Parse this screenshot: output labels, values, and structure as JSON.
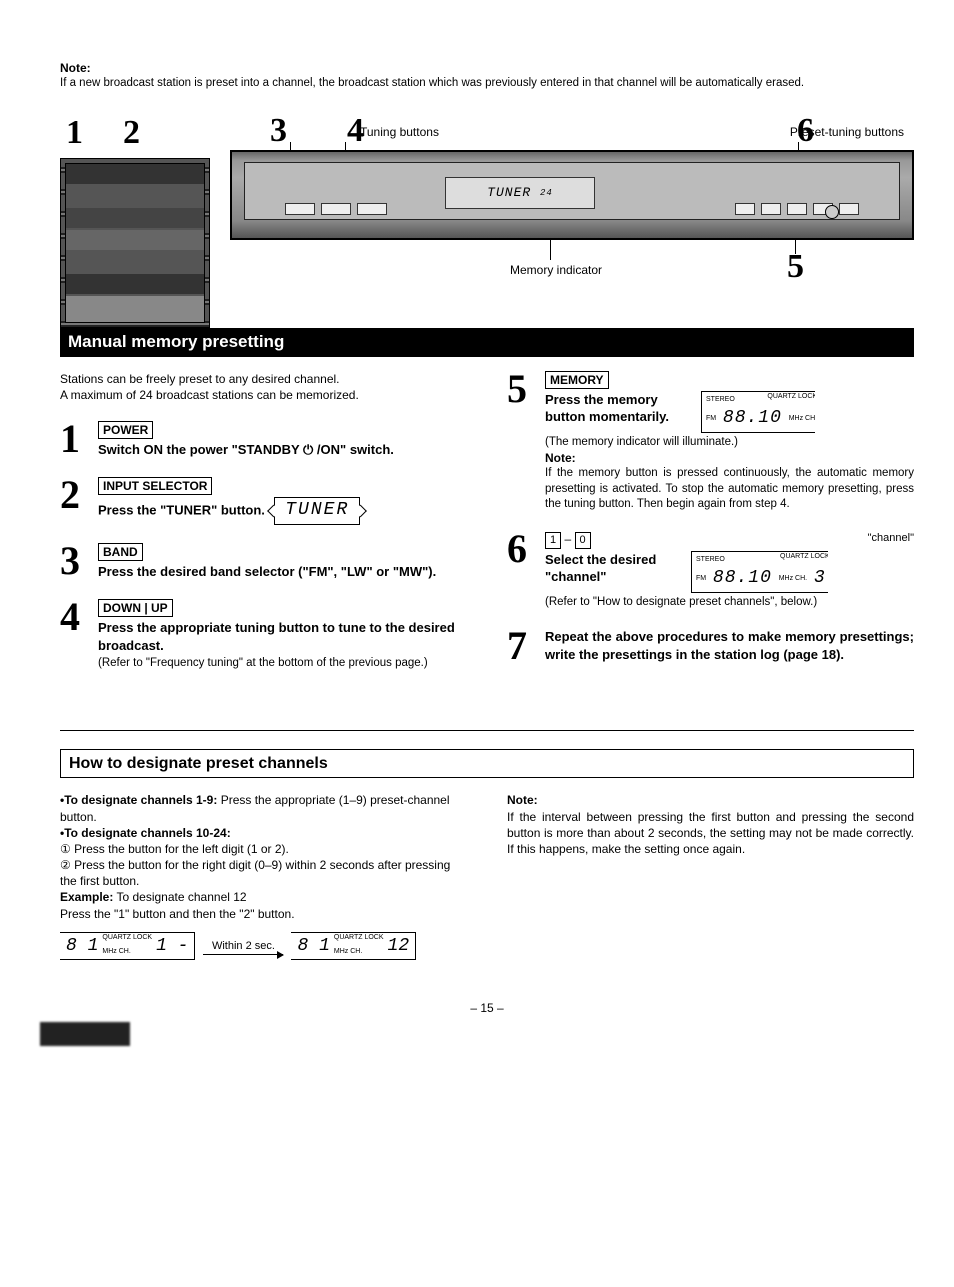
{
  "top_note": {
    "label": "Note:",
    "text": "If a new broadcast station is preset into a channel, the broadcast station which was previously entered in that channel will be automatically erased."
  },
  "diagram": {
    "n1": "1",
    "n2": "2",
    "n3": "3",
    "n4": "4",
    "n5": "5",
    "n6": "6",
    "tuning_buttons": "Tuning buttons",
    "preset_buttons": "Preset-tuning buttons",
    "memory_indicator": "Memory indicator",
    "display_word": "TUNER",
    "display_suffix": "24"
  },
  "section_title": "Manual memory presetting",
  "intro1": "Stations can be freely preset to any desired channel.",
  "intro2": "A maximum of 24 broadcast stations can be memorized.",
  "steps": {
    "s1": {
      "num": "1",
      "tag": "POWER",
      "title": "Switch ON the power \"STANDBY ⏻ /ON\" switch."
    },
    "s2": {
      "num": "2",
      "tag": "INPUT SELECTOR",
      "title": "Press the \"TUNER\" button.",
      "disp": "TUNER"
    },
    "s3": {
      "num": "3",
      "tag": "BAND",
      "title": "Press the desired band selector (\"FM\", \"LW\" or \"MW\")."
    },
    "s4": {
      "num": "4",
      "tag": "DOWN | UP",
      "title": "Press the appropriate tuning button to tune to the desired broadcast.",
      "sub": "(Refer to \"Frequency tuning\" at the bottom of the previous page.)"
    },
    "s5": {
      "num": "5",
      "tag": "MEMORY",
      "title_a": "Press the memory button momentarily.",
      "disp_stereo": "STEREO",
      "disp_fm": "FM",
      "disp_freq": "88.10",
      "disp_unit": "MHz CH.",
      "disp_ql": "QUARTZ LOCK",
      "sub1": "(The memory indicator will illuminate.)",
      "note_label": "Note:",
      "note": "If the memory button is pressed continuously, the automatic memory presetting is activated. To stop the automatic memory presetting, press the tuning button. Then begin again from step 4."
    },
    "s6": {
      "num": "6",
      "key1": "1",
      "dash": "–",
      "key0": "0",
      "chan": "\"channel\"",
      "title": "Select the desired \"channel\"",
      "disp_stereo": "STEREO",
      "disp_fm": "FM",
      "disp_freq": "88.10",
      "disp_unit": "MHz CH.",
      "disp_ql": "QUARTZ LOCK",
      "disp_ch": "3",
      "sub": "(Refer to \"How to designate preset channels\", below.)"
    },
    "s7": {
      "num": "7",
      "title": "Repeat the above procedures to make memory presettings; write the presettings in the station log (page 18)."
    }
  },
  "how_title": "How to designate preset channels",
  "how": {
    "lead1": "•To designate channels 1-9:",
    "lead1_text": "Press the appropriate (1–9) preset-channel button.",
    "lead2": "•To designate channels 10-24:",
    "c1": "①",
    "c1_text": "Press the button for the left digit (1 or 2).",
    "c2": "②",
    "c2_text": "Press the button for the right digit (0–9) within 2 seconds after pressing the first button.",
    "example_label": "Example:",
    "example_text": "To designate channel 12",
    "example_line": "Press the \"1\" button and then the \"2\" button.",
    "within": "Within 2 sec.",
    "d1_freq": "8 1",
    "d1_unit": "MHz CH.",
    "d1_ql": "QUARTZ LOCK",
    "d1_ch": "1 -",
    "d2_freq": "8 1",
    "d2_unit": "MHz CH.",
    "d2_ql": "QUARTZ LOCK",
    "d2_ch": "12",
    "note_label": "Note:",
    "note": "If the interval between pressing the first button and pressing the second button is more than about 2 seconds, the setting may not be made correctly. If this happens, make the setting once again."
  },
  "page": "– 15 –"
}
